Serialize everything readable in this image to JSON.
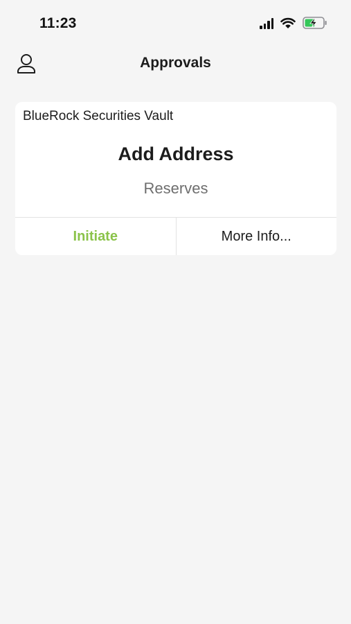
{
  "status_bar": {
    "time": "11:23"
  },
  "header": {
    "title": "Approvals",
    "profile_icon": "user-profile-icon"
  },
  "approvals": [
    {
      "vault": "BlueRock Securities Vault",
      "title": "Add Address",
      "subtitle": "Reserves",
      "actions": {
        "initiate_label": "Initiate",
        "more_info_label": "More Info..."
      }
    }
  ],
  "colors": {
    "background": "#f5f5f5",
    "card": "#ffffff",
    "accent_green": "#8bc34a",
    "battery_green": "#34c759",
    "text_primary": "#1c1c1c",
    "text_secondary": "#6e6e6e"
  }
}
